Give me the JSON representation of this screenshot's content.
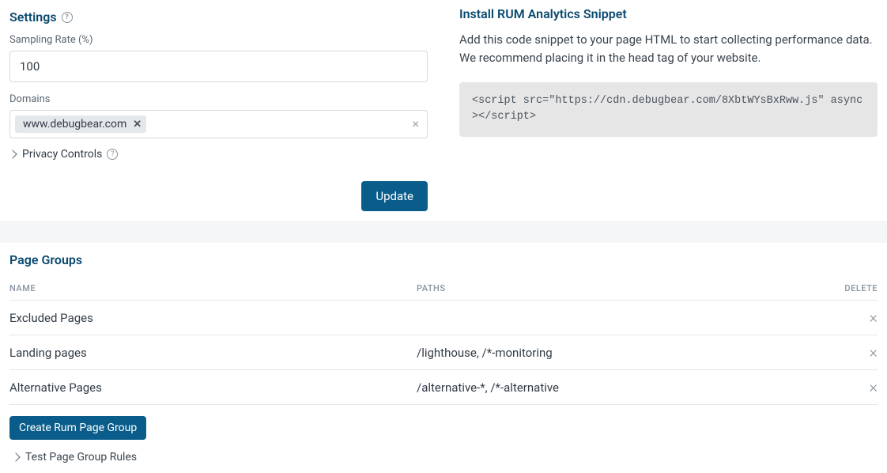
{
  "settings": {
    "title": "Settings",
    "sampling_rate_label": "Sampling Rate (%)",
    "sampling_rate_value": "100",
    "domains_label": "Domains",
    "domain_tags": [
      "www.debugbear.com"
    ],
    "privacy_controls_label": "Privacy Controls",
    "update_button": "Update"
  },
  "snippet": {
    "title": "Install RUM Analytics Snippet",
    "description": "Add this code snippet to your page HTML to start collecting performance data. We recommend placing it in the head tag of your website.",
    "code": "<script src=\"https://cdn.debugbear.com/8XbtWYsBxRww.js\" async></script>"
  },
  "page_groups": {
    "title": "Page Groups",
    "columns": {
      "name": "NAME",
      "paths": "PATHS",
      "delete": "DELETE"
    },
    "rows": [
      {
        "name": "Excluded Pages",
        "paths": ""
      },
      {
        "name": "Landing pages",
        "paths": "/lighthouse, /*-monitoring"
      },
      {
        "name": "Alternative Pages",
        "paths": "/alternative-*, /*-alternative"
      }
    ],
    "create_button": "Create Rum Page Group",
    "test_rules_label": "Test Page Group Rules"
  }
}
